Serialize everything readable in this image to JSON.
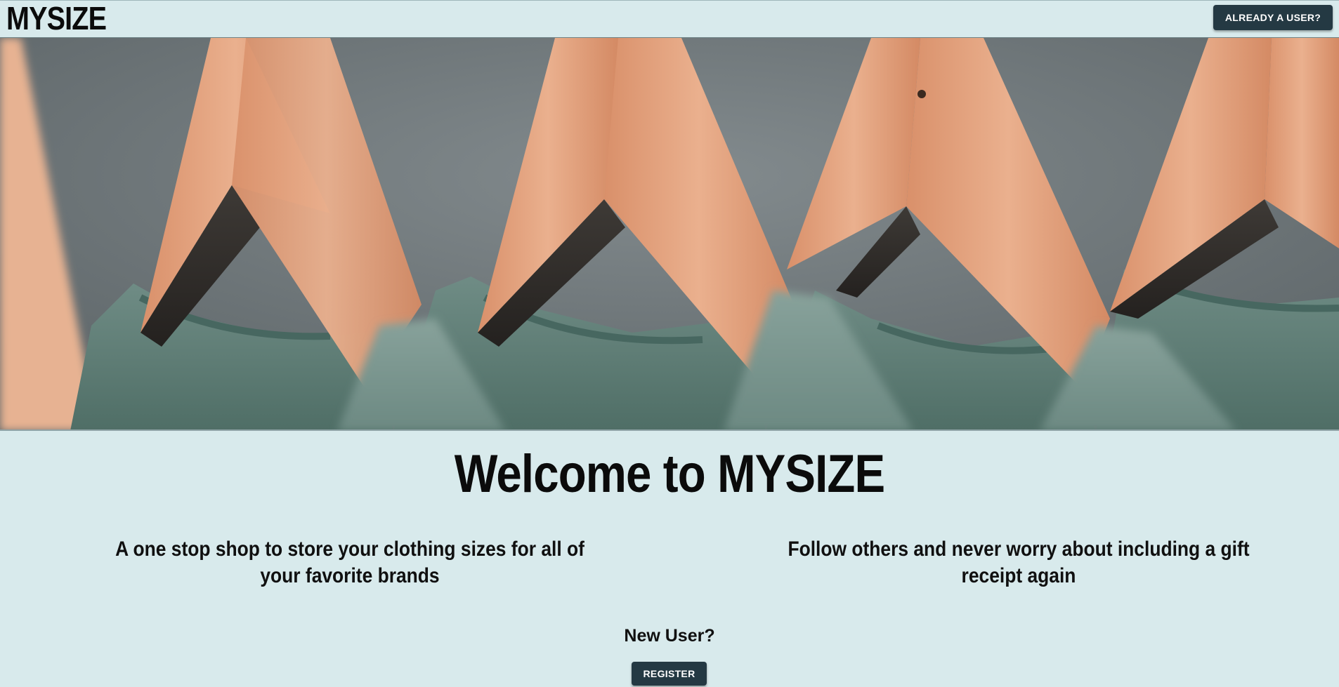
{
  "navbar": {
    "brand": "MYSIZE",
    "login_button": "ALREADY A USER?"
  },
  "hero": {
    "image": "hero-image-wooden-hangers-green-shirts"
  },
  "main": {
    "title": "Welcome to MYSIZE",
    "features": [
      "A one stop shop to store your clothing sizes for all of your favorite brands",
      "Follow others and never worry about including a gift receipt again"
    ],
    "new_user_label": "New User?",
    "register_button": "REGISTER"
  },
  "colors": {
    "background": "#d8eaec",
    "button": "#243943",
    "button_text": "#ffffff",
    "hanger_wood": "#e0a27e",
    "shirt_green": "#5f7f77"
  }
}
